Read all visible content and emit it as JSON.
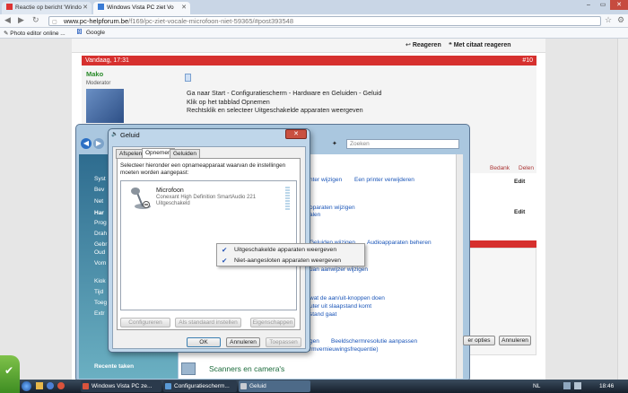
{
  "browser": {
    "tabs": [
      {
        "label": "Reactie op bericht 'Windo",
        "favicon": "gmail-icon"
      },
      {
        "label": "Windows Vista PC ziet Vo",
        "favicon": "forum-icon"
      }
    ],
    "url_host": "www.pc-helpforum.be",
    "url_path": "/f169/pc-ziet-vocale-microfoon-niet-59365/#post393548",
    "bookmarks": [
      "Photo editor online ...",
      "Google"
    ]
  },
  "forum": {
    "reply_button": "Reageren",
    "quote_reply_button": "Met citaat reageren",
    "post_date": "Vandaag, 17:31",
    "post_number": "#10",
    "author": "Mako",
    "role": "Moderator",
    "body_lines": [
      "Ga naar Start - Configuratiescherm - Hardware en Geluiden - Geluid",
      "Klik op het tabblad Opnemen",
      "Rechtsklik en selecteer Uitgeschakelde apparaten weergeven"
    ],
    "thanks_link": "Bedank",
    "share_link": "Delen",
    "side_buttons": [
      "Edit",
      "Edit",
      "Edit"
    ]
  },
  "control_panel": {
    "search_placeholder": "Zoeken",
    "side_items": [
      "Syst",
      "Bev",
      "Net",
      "Har",
      "Prog",
      "Drah",
      "Gebr",
      "Oud",
      "Vorn",
      "Kiok",
      "Tijd",
      "Toeg",
      "Extr"
    ],
    "recent_tasks": "Recente taken",
    "links": [
      "nter wijzigen",
      "Een printer verwijderen",
      "oparaten wijzigen",
      "alen",
      "Geluiden wijzigen",
      "Audioapparaten beheren",
      "uan aanwijzer wijzigen",
      "wat de aan/uit-knoppen doen",
      "uter uit slaapstand komt",
      "stand gaat",
      "gen",
      "Beeldschermresolutie aanpassen",
      "rmvernieuwingsfrequentie)"
    ],
    "scanners_heading": "Scanners en camera's",
    "bottom_buttons": [
      "er opties",
      "Annuleren"
    ]
  },
  "dialog": {
    "title": "Geluid",
    "tabs": [
      "Afspelen",
      "Opnemen",
      "Geluiden"
    ],
    "selected_tab": "Opnemen",
    "instruction": "Selecteer hieronder een opnameapparaat waarvan de instellingen moeten worden aangepast:",
    "device": {
      "name": "Microfoon",
      "driver": "Conexant High Definition SmartAudio 221",
      "status": "Uitgeschakeld"
    },
    "configure": "Configureren",
    "set_default": "Als standaard instellen",
    "properties": "Eigenschappen",
    "ok": "OK",
    "cancel": "Annuleren",
    "apply": "Toepassen"
  },
  "context_menu": {
    "items": [
      {
        "label": "Uitgeschakelde apparaten weergeven",
        "checked": true
      },
      {
        "label": "Niet-aangesloten apparaten weergeven",
        "checked": true
      }
    ]
  },
  "taskbar": {
    "tasks": [
      "Windows Vista PC ze...",
      "Configuratiescherm...",
      "Geluid"
    ],
    "language": "NL",
    "clock": "18:46"
  },
  "colors": {
    "forum_red": "#d6302e",
    "link_blue": "#1a55b8",
    "check_blue": "#1f4fb4"
  }
}
